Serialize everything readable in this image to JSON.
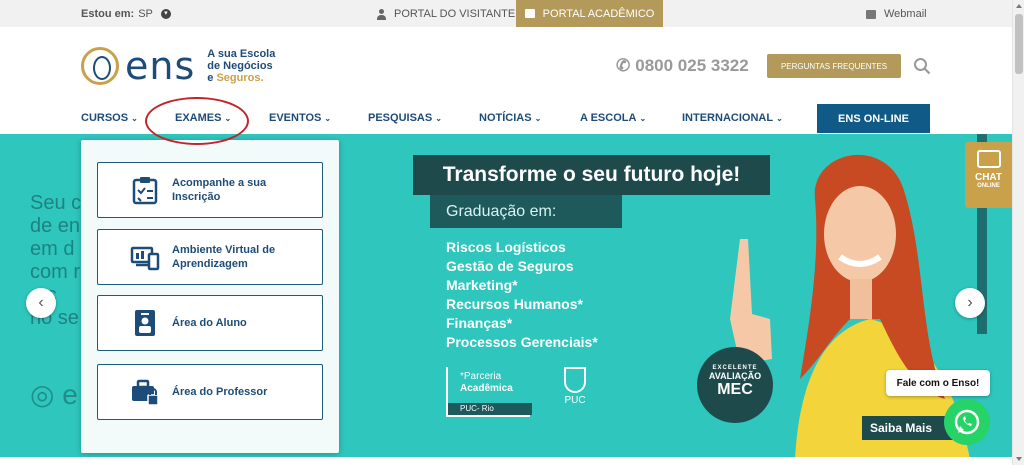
{
  "topbar": {
    "location_label": "Estou em:",
    "location_value": "SP",
    "visitor_portal": "PORTAL DO VISITANTE",
    "academic_portal": "PORTAL ACADÊMICO",
    "webmail": "Webmail"
  },
  "header": {
    "logo_word": "ens",
    "tagline_1": "A sua Escola",
    "tagline_2": "de Negócios",
    "tagline_3a": "e ",
    "tagline_3b": "Seguros.",
    "phone": "0800 025 3322",
    "faq_button": "PERGUNTAS FREQUENTES"
  },
  "nav": {
    "items": [
      {
        "label": "CURSOS"
      },
      {
        "label": "EXAMES"
      },
      {
        "label": "EVENTOS"
      },
      {
        "label": "PESQUISAS"
      },
      {
        "label": "NOTÍCIAS"
      },
      {
        "label": "A ESCOLA"
      },
      {
        "label": "INTERNACIONAL"
      }
    ],
    "online_button": "ENS ON-LINE"
  },
  "dropdown": {
    "items": [
      {
        "line1": "Acompanhe a sua",
        "line2": "Inscrição",
        "icon": "clipboard-check-icon"
      },
      {
        "line1": "Ambiente Virtual de",
        "line2": "Aprendizagem",
        "icon": "devices-icon"
      },
      {
        "line1": "Área do Aluno",
        "line2": "",
        "icon": "student-id-icon"
      },
      {
        "line1": "Área do Professor",
        "line2": "",
        "icon": "briefcase-lock-icon"
      }
    ]
  },
  "hero": {
    "ghost_lines": [
      "Seu c",
      "de en",
      "em d",
      "com r",
      "e c",
      "no se"
    ],
    "headline": "Transforme o seu futuro hoje!",
    "subheading": "Graduação em:",
    "courses": [
      "Riscos Logísticos",
      "Gestão de Seguros",
      "Marketing*",
      "Recursos Humanos*",
      "Finanças*",
      "Processos Gerenciais*"
    ],
    "parceria_1": "*Parceria",
    "parceria_2": "Acadêmica",
    "parceria_3": "PUC- Rio",
    "puc_label": "PUC",
    "mec_1": "EXCELENTE",
    "mec_2": "AVALIAÇÃO",
    "mec_3": "MEC",
    "saiba_mais": "Saiba Mais"
  },
  "chat": {
    "label": "CHAT",
    "sub": "ONLINE"
  },
  "fale": "Fale com o Enso!",
  "colors": {
    "gold": "#b39a5a",
    "navy": "#1e4c78",
    "teal": "#2ec6bd",
    "dark_teal": "#1e4a4c"
  }
}
